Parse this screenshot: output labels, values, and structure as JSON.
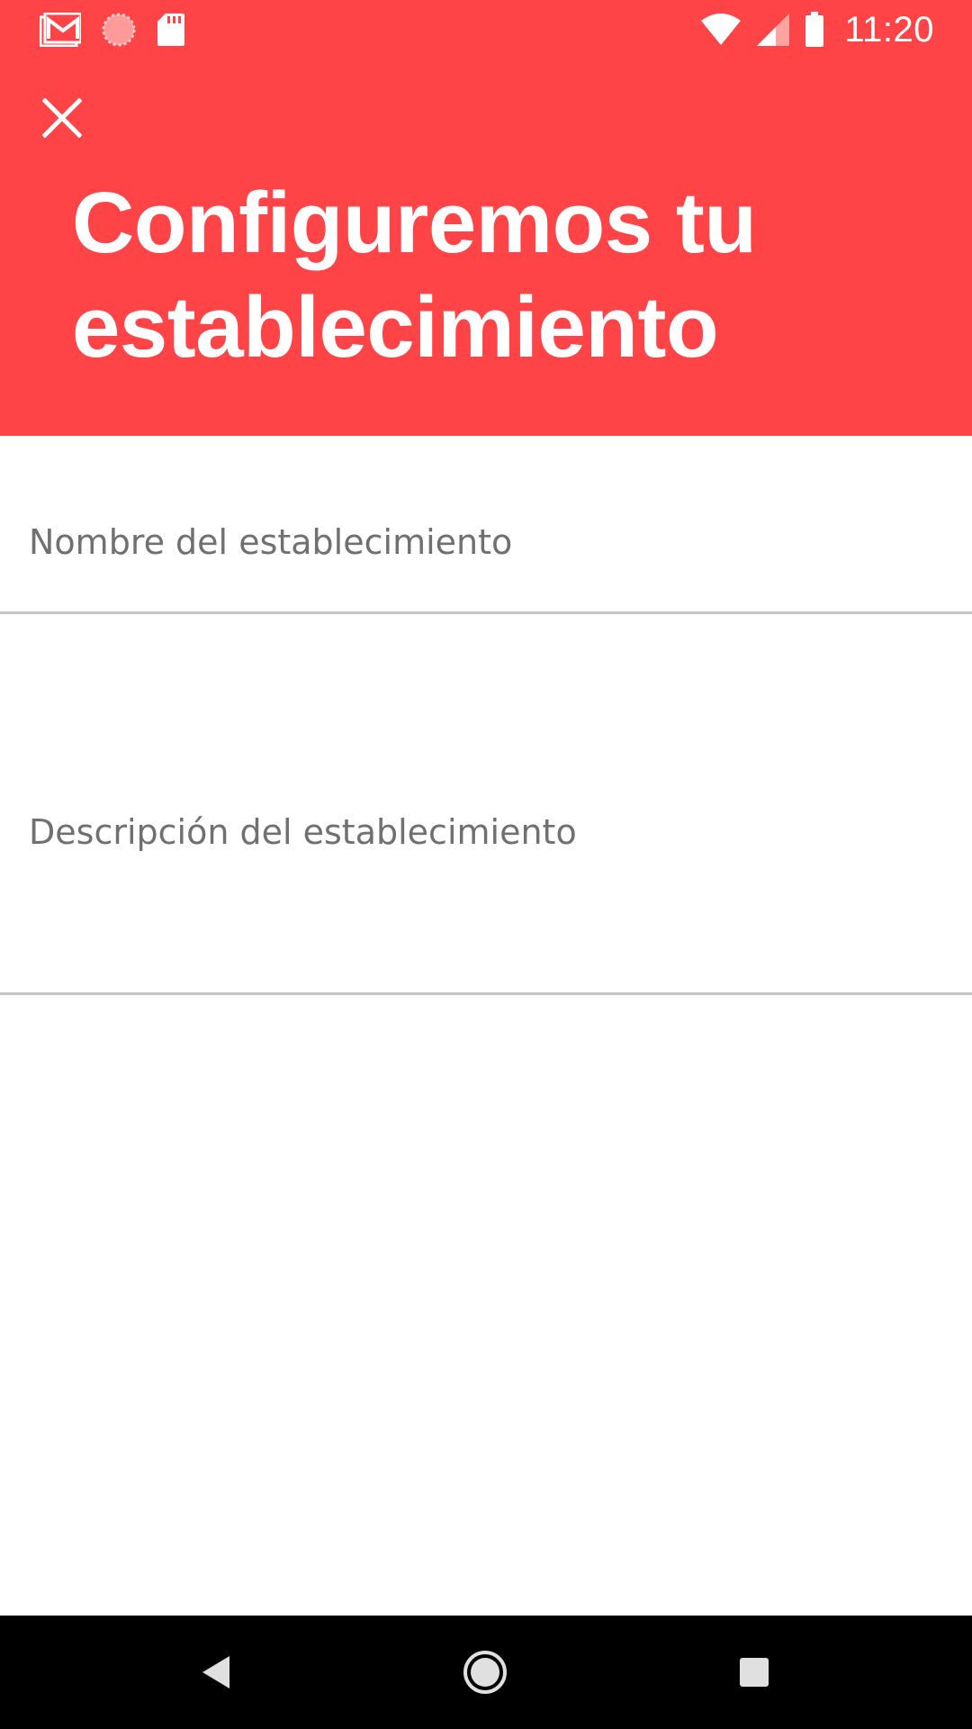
{
  "status_bar": {
    "time": "11:20",
    "left_icons": [
      "gmail-icon",
      "sync-icon",
      "sd-card-icon"
    ],
    "right_icons": [
      "wifi-icon",
      "cell-signal-icon",
      "battery-icon"
    ]
  },
  "header": {
    "close_icon": "close-icon",
    "title_line1": "Configuremos tu",
    "title_line2": "establecimiento",
    "background_color": "#ff4447"
  },
  "form": {
    "name_field": {
      "placeholder": "Nombre del establecimiento",
      "value": ""
    },
    "description_field": {
      "placeholder": "Descripción del establecimiento",
      "value": ""
    }
  },
  "nav_bar": {
    "buttons": [
      "back-icon",
      "home-icon",
      "recents-icon"
    ]
  }
}
